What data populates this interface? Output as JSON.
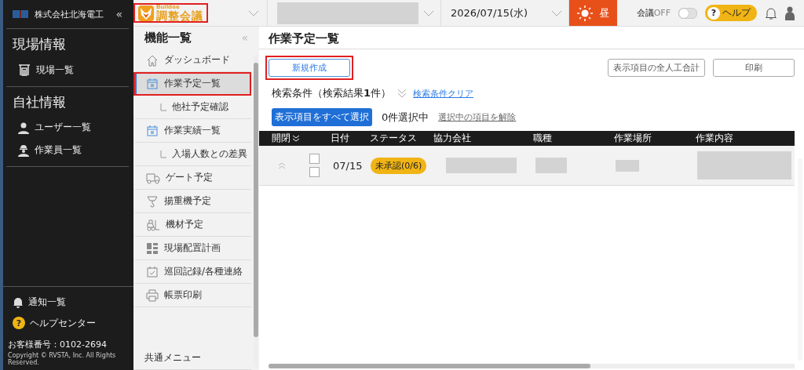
{
  "sidebar": {
    "company": "株式会社北海電工",
    "collapse": "«",
    "sections": [
      {
        "title": "現場情報",
        "items": [
          {
            "label": "現場一覧"
          }
        ]
      },
      {
        "title": "自社情報",
        "items": [
          {
            "label": "ユーザー一覧"
          },
          {
            "label": "作業員一覧"
          }
        ]
      }
    ],
    "notice": "通知一覧",
    "help_mark": "?",
    "help_center": "ヘルプセンター",
    "customer_no": "お客様番号：0102-2694",
    "copyright": "Copyright © RVSTA, Inc. All Rights Reserved."
  },
  "topbar": {
    "logo_small": "Buildee",
    "logo": "調整会議",
    "date": "2026/07/15(水)",
    "time_of_day": "昼",
    "meeting_label": "会議",
    "meeting_state": "OFF",
    "meeting_on": false,
    "help_mark": "?",
    "help": "ヘルプ"
  },
  "menu": {
    "title": "機能一覧",
    "collapse": "«",
    "items": [
      {
        "label": "ダッシュボード",
        "kind": "item",
        "selected": false
      },
      {
        "label": "作業予定一覧",
        "kind": "item",
        "selected": true
      },
      {
        "label": "他社予定確認",
        "kind": "sub",
        "selected": false
      },
      {
        "label": "作業実績一覧",
        "kind": "item",
        "selected": false
      },
      {
        "label": "入場人数との差異",
        "kind": "sub",
        "selected": false
      },
      {
        "label": "ゲート予定",
        "kind": "item",
        "selected": false
      },
      {
        "label": "揚重機予定",
        "kind": "item",
        "selected": false
      },
      {
        "label": "機材予定",
        "kind": "item",
        "selected": false
      },
      {
        "label": "現場配置計画",
        "kind": "item",
        "selected": false
      },
      {
        "label": "巡回記録/各種連絡",
        "kind": "item",
        "selected": false
      },
      {
        "label": "帳票印刷",
        "kind": "item",
        "selected": false
      }
    ],
    "common": "共通メニュー"
  },
  "main": {
    "title": "作業予定一覧",
    "new_button": "新規作成",
    "total_button": "表示項目の全人工合計",
    "print_button": "印刷",
    "search_label": "検索条件（検索結果**1**件）",
    "clear_link": "検索条件クリア",
    "select_all": "表示項目をすべて選択",
    "selected_count": "0件選択中",
    "deselect_link": "選択中の項目を解除",
    "table": {
      "columns": [
        "開閉",
        "日付",
        "ステータス",
        "協力会社",
        "職種",
        "作業場所",
        "作業内容"
      ],
      "rows": [
        {
          "date": "07/15",
          "status": "未承認(0/6)",
          "checks": [
            false,
            false
          ]
        }
      ]
    }
  }
}
